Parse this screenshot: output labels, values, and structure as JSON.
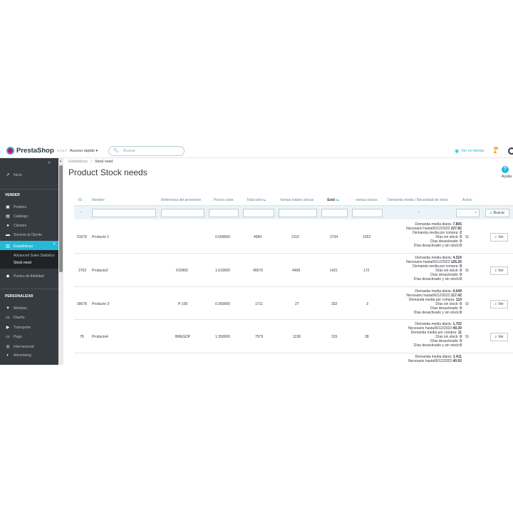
{
  "header": {
    "logo_text": "PrestaShop",
    "version": "1.7.6.7",
    "quick_access": "Acceso rápido ▾",
    "search_placeholder": "Buscar",
    "my_store": "Ver mi tienda",
    "notif_count": "11",
    "icons": {
      "search": "search-icon",
      "eye": "eye-icon",
      "bell": "bell-icon",
      "profile": "profile-icon"
    }
  },
  "sidebar": {
    "collapse": "«",
    "inicio": "Inicio",
    "vender": "VENDER",
    "items": [
      {
        "label": "Pedidos",
        "icon": "cart-icon"
      },
      {
        "label": "Catálogo",
        "icon": "store-icon"
      },
      {
        "label": "Clientes",
        "icon": "user-icon"
      },
      {
        "label": "Servicio al Cliente",
        "icon": "chat-icon"
      },
      {
        "label": "Estadísticas",
        "icon": "chart-icon"
      }
    ],
    "sub_items": [
      "Advanced Sales Statistics",
      "Stock need"
    ],
    "fidelidad": "Puntos de fidelidad",
    "personalizar": "PERSONALIZAR",
    "items2": [
      {
        "label": "Módulos",
        "icon": "puzzle-icon"
      },
      {
        "label": "Diseño",
        "icon": "desktop-icon"
      },
      {
        "label": "Transporte",
        "icon": "truck-icon"
      },
      {
        "label": "Pago",
        "icon": "card-icon"
      },
      {
        "label": "Internacional",
        "icon": "globe-icon"
      },
      {
        "label": "Advertising",
        "icon": "advertising-icon"
      }
    ]
  },
  "toolbar": {
    "breadcrumb_parent": "Estadísticas",
    "breadcrumb_sep": "/",
    "breadcrumb_current": "Stock need",
    "title": "Product Stock needs",
    "help": "Ayuda"
  },
  "table": {
    "columns": [
      "ID",
      "Nombre",
      "Referencia del proveedor",
      "Precio coste",
      "Total sold",
      "Ventas totales únicas",
      "Sold",
      "ventas únicas",
      "Demanda media / Necesidad de stock",
      "Activo"
    ],
    "filter_dash": "--",
    "active_filter": "-",
    "search_button": "Buscar",
    "view_button": "Ver",
    "demand_labels": {
      "daily": "Demanda media diaria: ",
      "needed": "Necesario hasta06/12/2022:",
      "per_purchase": "Demanda media por compra: ",
      "days_no_stock": "Días sin stock: ",
      "days_disabled": "Días desactivado: ",
      "days_disabled_nostock": "Días desactivado y sin stock:"
    },
    "rows": [
      {
        "id": "51678",
        "name": "Producto 1",
        "ref": "",
        "cost": "0.000000",
        "total_sold": "4084",
        "unique_total": "2110",
        "sold": "2734",
        "unique": "1252",
        "daily": "7.856",
        "needed": "227.82",
        "per_purchase": "2",
        "no_stock": "0",
        "disabled": "0",
        "disabled_nostock": "0",
        "active": "Sí"
      },
      {
        "id": "2702",
        "name": "Producto2",
        "ref": "F20992",
        "cost": "1.610000",
        "total_sold": "40579",
        "unique_total": "4468",
        "sold": "1421",
        "unique": "172",
        "daily": "4.316",
        "needed": "126.26",
        "per_purchase": "8",
        "no_stock": "0",
        "disabled": "0",
        "disabled_nostock": "0",
        "active": "Sí"
      },
      {
        "id": "39678",
        "name": "Producto 3",
        "ref": "P-100",
        "cost": "0.350000",
        "total_sold": "1711",
        "unique_total": "27",
        "sold": "332",
        "unique": "3",
        "daily": "4.049",
        "needed": "117.42",
        "per_purchase": "110",
        "no_stock": "0",
        "disabled": "0",
        "disabled_nostock": "0",
        "active": "Sí"
      },
      {
        "id": "78",
        "name": "Producto4",
        "ref": "BREGDP",
        "cost": "1.350000",
        "total_sold": "7579",
        "unique_total": "1158",
        "sold": "315",
        "unique": "28",
        "daily": "1.702",
        "needed": "49.39",
        "per_purchase": "11",
        "no_stock": "0",
        "disabled": "0",
        "disabled_nostock": "0",
        "active": "Sí"
      },
      {
        "id": "",
        "name": "",
        "ref": "",
        "cost": "",
        "total_sold": "",
        "unique_total": "",
        "sold": "",
        "unique": "",
        "daily": "1.411",
        "needed": "40.92",
        "per_purchase": "",
        "no_stock": "",
        "disabled": "",
        "disabled_nostock": "",
        "active": ""
      }
    ]
  },
  "colors": {
    "accent": "#25b9d7",
    "sidebar": "#363a41",
    "brand": "#df0067"
  }
}
